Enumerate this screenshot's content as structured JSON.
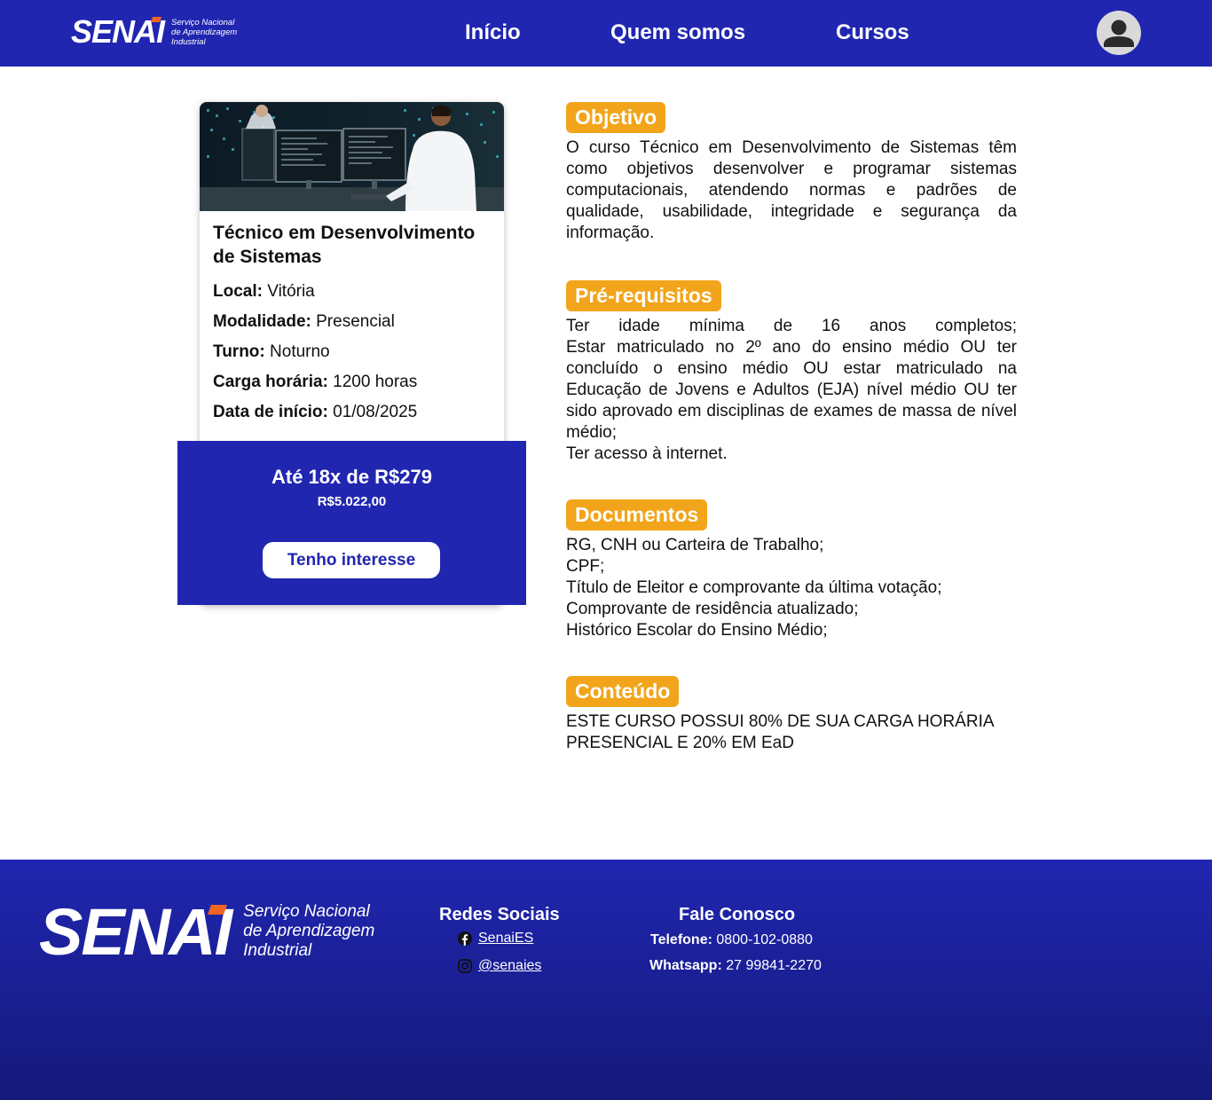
{
  "header": {
    "logo_text": "SENAI",
    "logo_subtitle_1": "Serviço Nacional",
    "logo_subtitle_2": "de Aprendizagem",
    "logo_subtitle_3": "Industrial",
    "nav": [
      "Início",
      "Quem somos",
      "Cursos"
    ],
    "avatar_icon": "user-icon"
  },
  "course": {
    "title": "Técnico em Desenvolvimento de Sistemas",
    "local_label": "Local:",
    "local_value": "Vitória",
    "modalidade_label": "Modalidade:",
    "modalidade_value": "Presencial",
    "turno_label": "Turno:",
    "turno_value": "Noturno",
    "carga_label": "Carga horária:",
    "carga_value": "1200 horas",
    "inicio_label": "Data de início:",
    "inicio_value": "01/08/2025",
    "installments": "Até 18x de R$279",
    "total": "R$5.022,00",
    "cta_label": "Tenho interesse"
  },
  "sections": {
    "objetivo_title": "Objetivo",
    "objetivo_text": "O curso Técnico em Desenvolvimento de Sistemas têm como objetivos desenvolver e programar sistemas computacionais, atendendo normas e padrões de qualidade, usabilidade, integridade e segurança da informação.",
    "prereq_title": "Pré-requisitos",
    "prereq_para1": "Ter idade mínima de 16 anos completos;",
    "prereq_para2": "Estar matriculado no 2º ano do ensino médio OU ter concluído o ensino médio OU estar matriculado na Educação de Jovens e Adultos (EJA) nível médio OU ter sido aprovado em disciplinas de exames de massa de nível médio;",
    "prereq_para3": "Ter acesso à internet.",
    "documentos_title": "Documentos",
    "documentos_items": [
      "RG, CNH ou Carteira de Trabalho;",
      "CPF;",
      "Título de Eleitor e comprovante da última votação;",
      "Comprovante de residência atualizado;",
      "Histórico Escolar do Ensino Médio;"
    ],
    "conteudo_title": "Conteúdo",
    "conteudo_line1": "ESTE CURSO POSSUI 80% DE SUA CARGA HORÁRIA",
    "conteudo_line2": "PRESENCIAL E 20% EM EaD"
  },
  "footer": {
    "logo_text": "SENAI",
    "logo_subtitle_1": "Serviço Nacional",
    "logo_subtitle_2": "de Aprendizagem",
    "logo_subtitle_3": "Industrial",
    "social_title": "Redes Sociais",
    "facebook": "SenaiES",
    "instagram": "@senaies",
    "contact_title": "Fale Conosco",
    "phone_label": "Telefone:",
    "phone_value": "0800-102-0880",
    "whatsapp_label": "Whatsapp:",
    "whatsapp_value": "27 99841-2270"
  },
  "colors": {
    "brand_blue": "#2026b0",
    "accent_orange": "#f2a51a",
    "logo_accent": "#f26522"
  }
}
